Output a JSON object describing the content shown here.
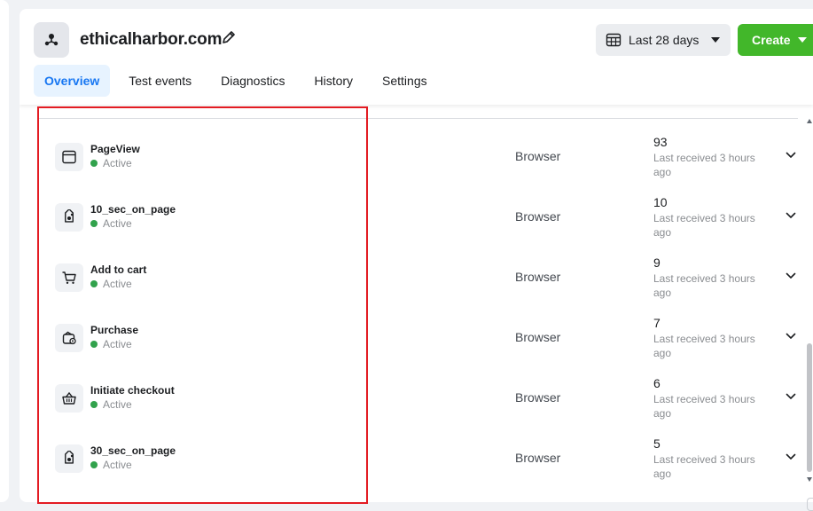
{
  "header": {
    "pixel_icon": "pixel-dataset-icon",
    "title": "ethicalharbor.com",
    "edit_icon": "pencil-icon",
    "date_range": {
      "label": "Last 28 days",
      "icon": "calendar-icon"
    },
    "create": {
      "label": "Create"
    }
  },
  "tabs": [
    {
      "label": "Overview",
      "active": true
    },
    {
      "label": "Test events",
      "active": false
    },
    {
      "label": "Diagnostics",
      "active": false
    },
    {
      "label": "History",
      "active": false
    },
    {
      "label": "Settings",
      "active": false
    }
  ],
  "events": [
    {
      "name": "PageView",
      "status": "Active",
      "source": "Browser",
      "count": "93",
      "received": "Last received 3 hours ago",
      "icon": "browser-window-icon"
    },
    {
      "name": "10_sec_on_page",
      "status": "Active",
      "source": "Browser",
      "count": "10",
      "received": "Last received 3 hours ago",
      "icon": "tag-icon"
    },
    {
      "name": "Add to cart",
      "status": "Active",
      "source": "Browser",
      "count": "9",
      "received": "Last received 3 hours ago",
      "icon": "cart-icon"
    },
    {
      "name": "Purchase",
      "status": "Active",
      "source": "Browser",
      "count": "7",
      "received": "Last received 3 hours ago",
      "icon": "wallet-icon"
    },
    {
      "name": "Initiate checkout",
      "status": "Active",
      "source": "Browser",
      "count": "6",
      "received": "Last received 3 hours ago",
      "icon": "basket-icon"
    },
    {
      "name": "30_sec_on_page",
      "status": "Active",
      "source": "Browser",
      "count": "5",
      "received": "Last received 3 hours ago",
      "icon": "tag-icon"
    }
  ],
  "colors": {
    "accent": "#1877f2",
    "create": "#42b72a",
    "active_dot": "#31a24c",
    "highlight": "#e31c23"
  }
}
